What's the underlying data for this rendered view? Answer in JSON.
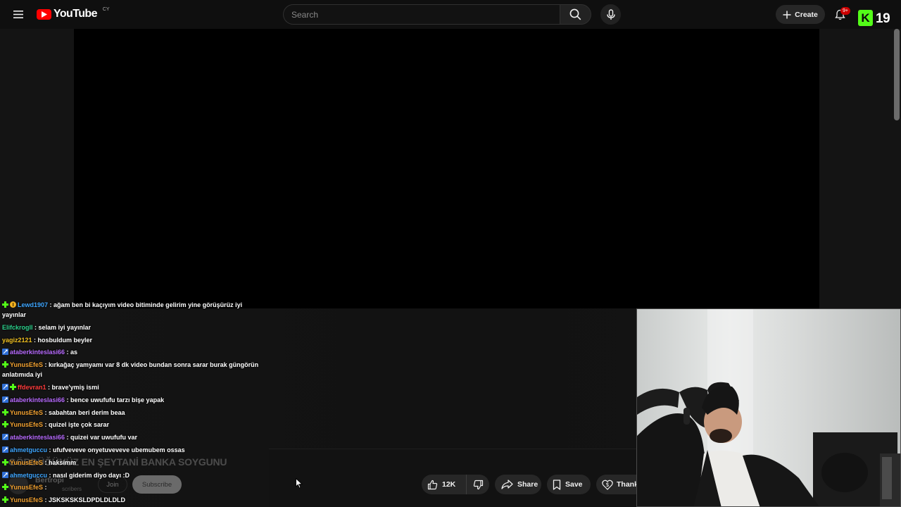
{
  "header": {
    "logo_text": "YouTube",
    "country_code": "CY",
    "search_placeholder": "Search",
    "create_label": "Create",
    "notification_count": "9+",
    "kick_logo_letter": "K",
    "kick_viewer_count": "19"
  },
  "chat": {
    "messages": [
      {
        "user": "Lewd1907",
        "user_color": "#3ea6ff",
        "text": ": ağam ben bi kaçıyım video bitiminde gelirim yine görüşürüz iyi yayınlar",
        "badges": [
          "sub",
          "gift"
        ]
      },
      {
        "user": "Elifckrogll",
        "user_color": "#2bd18c",
        "text": ": selam iyi yayınlar",
        "badges": []
      },
      {
        "user": "yagiz2121",
        "user_color": "#f0c020",
        "text": ": hosbuldum beyler",
        "badges": []
      },
      {
        "user": "ataberkinteslasi66",
        "user_color": "#b86bff",
        "text": ": as",
        "badges": [
          "mod"
        ]
      },
      {
        "user": "YunusEfeS",
        "user_color": "#f0a030",
        "text": ": kırkağaç yamyamı var 8 dk video bundan sonra sarar burak güngörün anlatımıda iyi",
        "badges": [
          "sub"
        ]
      },
      {
        "user": "ffdevran1",
        "user_color": "#ff3b3b",
        "text": ": brave'ymiş ismi",
        "badges": [
          "mod",
          "sub"
        ]
      },
      {
        "user": "ataberkinteslasi66",
        "user_color": "#b86bff",
        "text": ": bence uwufufu tarzı bişe yapak",
        "badges": [
          "mod"
        ]
      },
      {
        "user": "YunusEfeS",
        "user_color": "#f0a030",
        "text": ": sabahtan beri derim beaa",
        "badges": [
          "sub"
        ]
      },
      {
        "user": "YunusEfeS",
        "user_color": "#f0a030",
        "text": ": quizel işte çok sarar",
        "badges": [
          "sub"
        ]
      },
      {
        "user": "ataberkinteslasi66",
        "user_color": "#b86bff",
        "text": ": quizei var uwufufu var",
        "badges": [
          "mod"
        ]
      },
      {
        "user": "ahmetguccu",
        "user_color": "#3ea6ff",
        "text": ": ufufveveve onyetuveveve ubemubem ossas",
        "badges": [
          "mod"
        ]
      },
      {
        "user": "YunusEfeS",
        "user_color": "#f0a030",
        "text": ": haksimm",
        "badges": [
          "sub"
        ]
      },
      {
        "user": "ahmetguccu",
        "user_color": "#3ea6ff",
        "text": ": nasıl giderim diyo dayı :D",
        "badges": [
          "mod"
        ]
      },
      {
        "user": "YunusEfeS",
        "user_color": "#f0a030",
        "text": ":",
        "badges": [
          "sub"
        ]
      },
      {
        "user": "YunusEfeS",
        "user_color": "#f0a030",
        "text": ": JSKSKSKSLDPDLDLDLD",
        "badges": [
          "sub"
        ]
      }
    ]
  },
  "video": {
    "title": "GÖRDÜĞÜNÜZ EN ŞEYTANİ BANKA SOYGUNU",
    "channel_name": "Bertropi",
    "subscriber_text": "scribers",
    "join_label": "Join",
    "subscribe_label": "Subscribe",
    "like_count": "12K",
    "share_label": "Share",
    "save_label": "Save",
    "thanks_label": "Thanks"
  },
  "colors": {
    "background": "#0f0f0f",
    "youtube_red": "#ff0000",
    "kick_green": "#53fc18"
  }
}
